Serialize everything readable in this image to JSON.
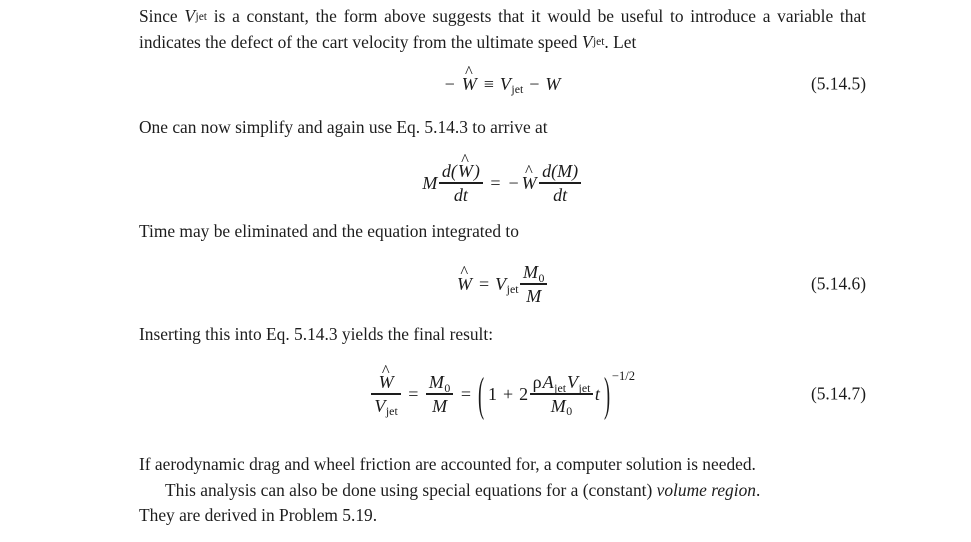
{
  "document": {
    "type": "textbook-page",
    "section": "5.14",
    "background_color": "#ffffff",
    "text_color": "#1d1d1d"
  },
  "paragraphs": {
    "p1": {
      "seg_a": "Since ",
      "var_v": "V",
      "var_v_sub": "jet",
      "seg_b": " is a constant, the form above suggests that it would be useful to introduce a variable that indicates the defect of the cart velocity from the ultimate speed ",
      "var_v2": "V",
      "var_v2_sub": "jet",
      "seg_c": ". Let"
    },
    "p2": "One can now simplify and again use Eq. 5.14.3 to arrive at",
    "p3": "Time may be eliminated and the equation integrated to",
    "p4": "Inserting this into Eq. 5.14.3 yields the final result:",
    "p5_line1": "If aerodynamic drag and wheel friction are accounted for, a computer solution is needed.",
    "p5_line2_a": "This analysis can also be done using special equations for a (constant) ",
    "p5_line2_ital": "volume region",
    "p5_line2_b": ".",
    "p5_line3": "They are derived in Problem 5.19."
  },
  "equations": {
    "eq5145": {
      "number": "(5.14.5)",
      "plain": "-Ŵ ≡ V_jet - W",
      "minus": "−",
      "w_hat_var": "W",
      "hat_mark": "^",
      "identity_op": "≡",
      "v_var": "V",
      "v_sub": "jet",
      "minus2": "−",
      "w_var": "W"
    },
    "eq_deriv": {
      "number": "",
      "plain": "M d(Ŵ)/dt = -Ŵ d(M)/dt",
      "m_var": "M",
      "num1_open": "d(",
      "num1_hat_var": "W",
      "hat_mark": "^",
      "num1_close": ")",
      "den1": "dt",
      "equals": "=",
      "minus": "−",
      "w_hat_var": "W",
      "num2": "d(M)",
      "den2": "dt"
    },
    "eq5146": {
      "number": "(5.14.6)",
      "plain": "Ŵ = V_jet M₀/M",
      "w_hat_var": "W",
      "hat_mark": "^",
      "equals": "=",
      "v_var": "V",
      "v_sub": "jet",
      "num": "M",
      "num_sub": "0",
      "den": "M"
    },
    "eq5147": {
      "number": "(5.14.7)",
      "plain": "Ŵ/V_jet = M₀/M = (1 + 2 ρ A_jet V_jet t / M₀)^(-1/2)",
      "lhs_num_var": "W",
      "hat_mark": "^",
      "lhs_den_var": "V",
      "lhs_den_sub": "jet",
      "equals1": "=",
      "mid_num": "M",
      "mid_num_sub": "0",
      "mid_den": "M",
      "equals2": "=",
      "paren_open": "(",
      "one": "1",
      "plus": "+",
      "two": "2",
      "rho": "ρ",
      "a_var": "A",
      "a_sub": "jet",
      "v_var": "V",
      "v_sub": "jet",
      "frac_den": "M",
      "frac_den_sub": "0",
      "t_var": "t",
      "paren_close": ")",
      "exponent": "−1/2"
    }
  }
}
